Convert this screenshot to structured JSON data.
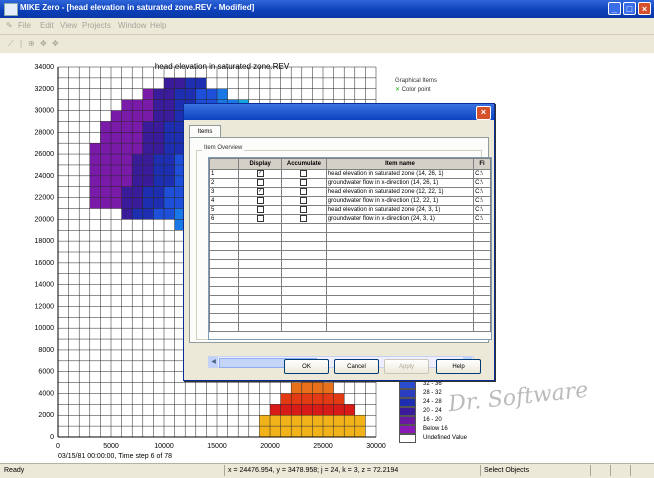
{
  "window": {
    "title": "MIKE Zero - [head elevation in saturated zone.REV - Modified]",
    "min": "_",
    "max": "□",
    "close": "×"
  },
  "menu": [
    "File",
    "Edit",
    "View",
    "Projects",
    "Window",
    "Help"
  ],
  "chart_data": {
    "type": "heatmap",
    "title": "head elevation in saturated zone.REV",
    "xlim": [
      0,
      30000
    ],
    "ylim": [
      0,
      34000
    ],
    "xticks": [
      0,
      5000,
      10000,
      15000,
      20000,
      25000,
      30000
    ],
    "yticks": [
      0,
      2000,
      4000,
      6000,
      8000,
      10000,
      12000,
      14000,
      16000,
      18000,
      20000,
      22000,
      24000,
      26000,
      28000,
      30000,
      32000,
      34000
    ],
    "time_caption": "03/15/81 00:00:00, Time step 6 of 78",
    "legend": [
      {
        "label": "32 - 36",
        "color": "#2b4ccf"
      },
      {
        "label": "28 - 32",
        "color": "#2a3cc0"
      },
      {
        "label": "24 - 28",
        "color": "#1d2fb0"
      },
      {
        "label": "20 - 24",
        "color": "#3a1c9a"
      },
      {
        "label": "16 - 20",
        "color": "#6a1aa0"
      },
      {
        "label": "Below 16",
        "color": "#8a1ab8"
      },
      {
        "label": "Undefined Value",
        "color": "#ffffff"
      }
    ],
    "graphical_items": [
      "Graphical Items",
      "Color point"
    ]
  },
  "dialog": {
    "tab": "Items",
    "group": "Item Overview",
    "columns": [
      "",
      "Display",
      "Accumulate",
      "Item name",
      "Fi"
    ],
    "rows": [
      {
        "no": "1",
        "display": true,
        "accumulate": false,
        "name": "head elevation in saturated zone (14, 26, 1)",
        "file": "C:\\"
      },
      {
        "no": "2",
        "display": false,
        "accumulate": false,
        "name": "groundwater flow in x-direction (14, 26, 1)",
        "file": "C:\\"
      },
      {
        "no": "3",
        "display": true,
        "accumulate": false,
        "name": "head elevation in saturated zone (12, 22, 1)",
        "file": "C:\\"
      },
      {
        "no": "4",
        "display": false,
        "accumulate": false,
        "name": "groundwater flow in x-direction (12, 22, 1)",
        "file": "C:\\"
      },
      {
        "no": "5",
        "display": false,
        "accumulate": false,
        "name": "head elevation in saturated zone (24, 3, 1)",
        "file": "C:\\"
      },
      {
        "no": "6",
        "display": false,
        "accumulate": false,
        "name": "groundwater flow in x-direction (24, 3, 1)",
        "file": "C:\\"
      }
    ],
    "buttons": {
      "ok": "OK",
      "cancel": "Cancel",
      "apply": "Apply",
      "help": "Help"
    }
  },
  "status": {
    "ready": "Ready",
    "coords": "x = 24476.954, y = 3478.958; j = 24, k = 3, z = 72.2194",
    "mode": "Select Objects"
  },
  "watermark": "Dr. Software"
}
